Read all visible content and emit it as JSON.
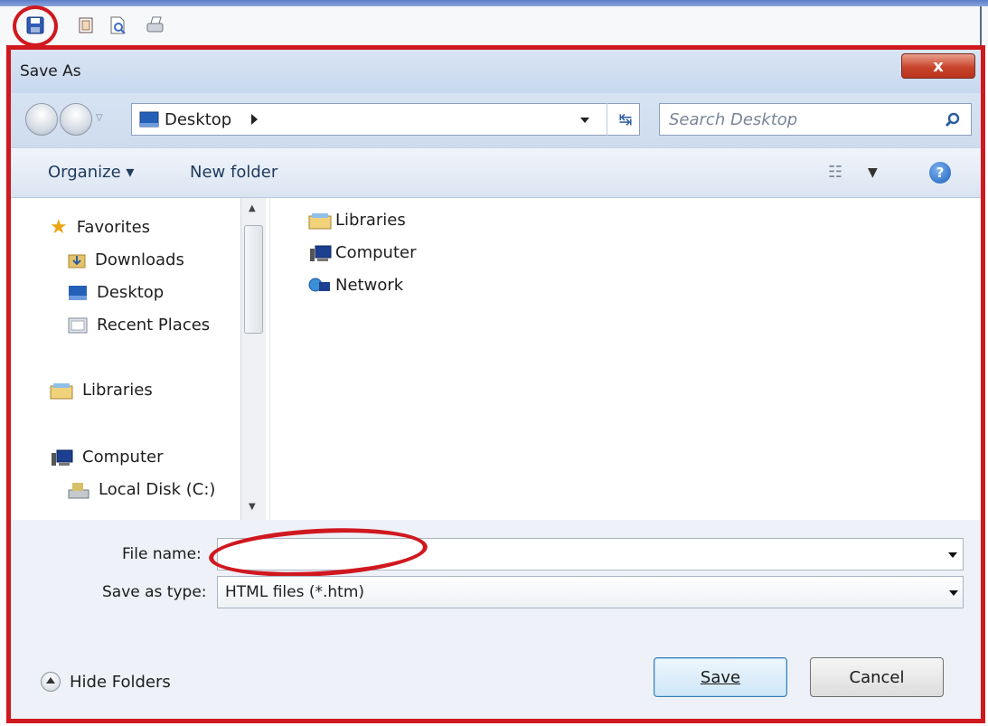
{
  "toolbar": {
    "icons": [
      "save-icon",
      "copy-icon",
      "print-preview-icon",
      "print-icon"
    ]
  },
  "dialog": {
    "title": "Save As",
    "close_label": "x",
    "address": {
      "location": "Desktop"
    },
    "search": {
      "placeholder": "Search Desktop"
    },
    "commands": {
      "organize": "Organize",
      "new_folder": "New folder"
    },
    "nav": {
      "favorites": "Favorites",
      "favorites_items": [
        "Downloads",
        "Desktop",
        "Recent Places"
      ],
      "libraries": "Libraries",
      "computer": "Computer",
      "computer_items": [
        "Local Disk (C:)"
      ]
    },
    "files": [
      "Libraries",
      "Computer",
      "Network"
    ],
    "file_name_label": "File name:",
    "file_name_value": "",
    "save_as_type_label": "Save as type:",
    "save_as_type_value": "HTML files (*.htm)",
    "hide_folders": "Hide Folders",
    "save_label": "Save",
    "cancel_label": "Cancel"
  },
  "colors": {
    "annotation_red": "#d0181f",
    "accent_blue": "#2c5d9c"
  }
}
